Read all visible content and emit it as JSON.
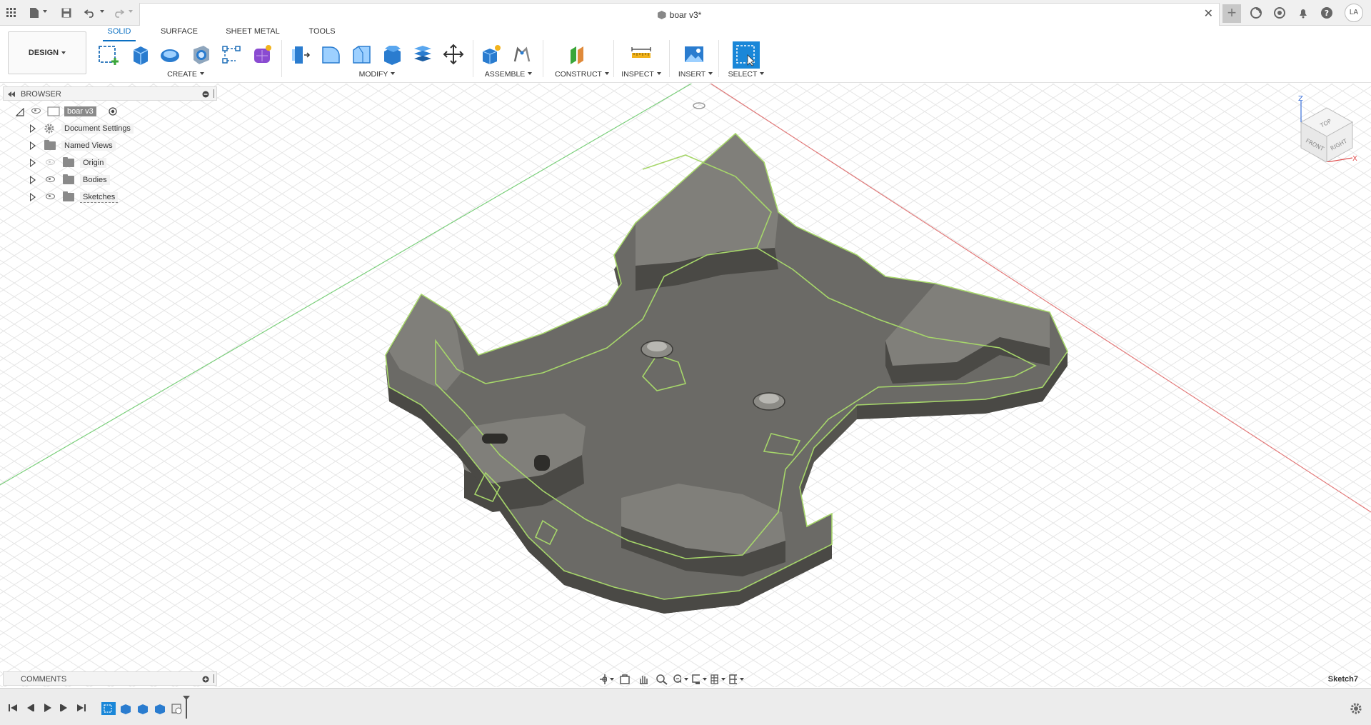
{
  "window": {
    "title": "boar v3*",
    "user_initials": "LA"
  },
  "toolbar": {
    "workspace_label": "DESIGN",
    "tabs": [
      {
        "label": "SOLID",
        "active": true
      },
      {
        "label": "SURFACE",
        "active": false
      },
      {
        "label": "SHEET METAL",
        "active": false
      },
      {
        "label": "TOOLS",
        "active": false
      }
    ],
    "groups": {
      "create": "CREATE",
      "modify": "MODIFY",
      "assemble": "ASSEMBLE",
      "construct": "CONSTRUCT",
      "inspect": "INSPECT",
      "insert": "INSERT",
      "select": "SELECT"
    }
  },
  "browser": {
    "title": "BROWSER",
    "root": "boar v3",
    "items": [
      {
        "label": "Document Settings",
        "icon": "gear-icon"
      },
      {
        "label": "Named Views",
        "icon": "folder-icon"
      },
      {
        "label": "Origin",
        "icon": "folder-icon"
      },
      {
        "label": "Bodies",
        "icon": "folder-icon"
      },
      {
        "label": "Sketches",
        "icon": "folder-icon"
      }
    ]
  },
  "comments": {
    "title": "COMMENTS"
  },
  "viewcube": {
    "top": "TOP",
    "front": "FRONT",
    "right": "RIGHT",
    "axis_z": "Z",
    "axis_x": "X"
  },
  "status": {
    "active_sketch": "Sketch7"
  },
  "colors": {
    "accent": "#0a6fc2",
    "model_body": "#6b6a66",
    "sketch_line": "#a6d66a",
    "axis_green": "#7ccf7c",
    "axis_red": "#e27a7a"
  }
}
